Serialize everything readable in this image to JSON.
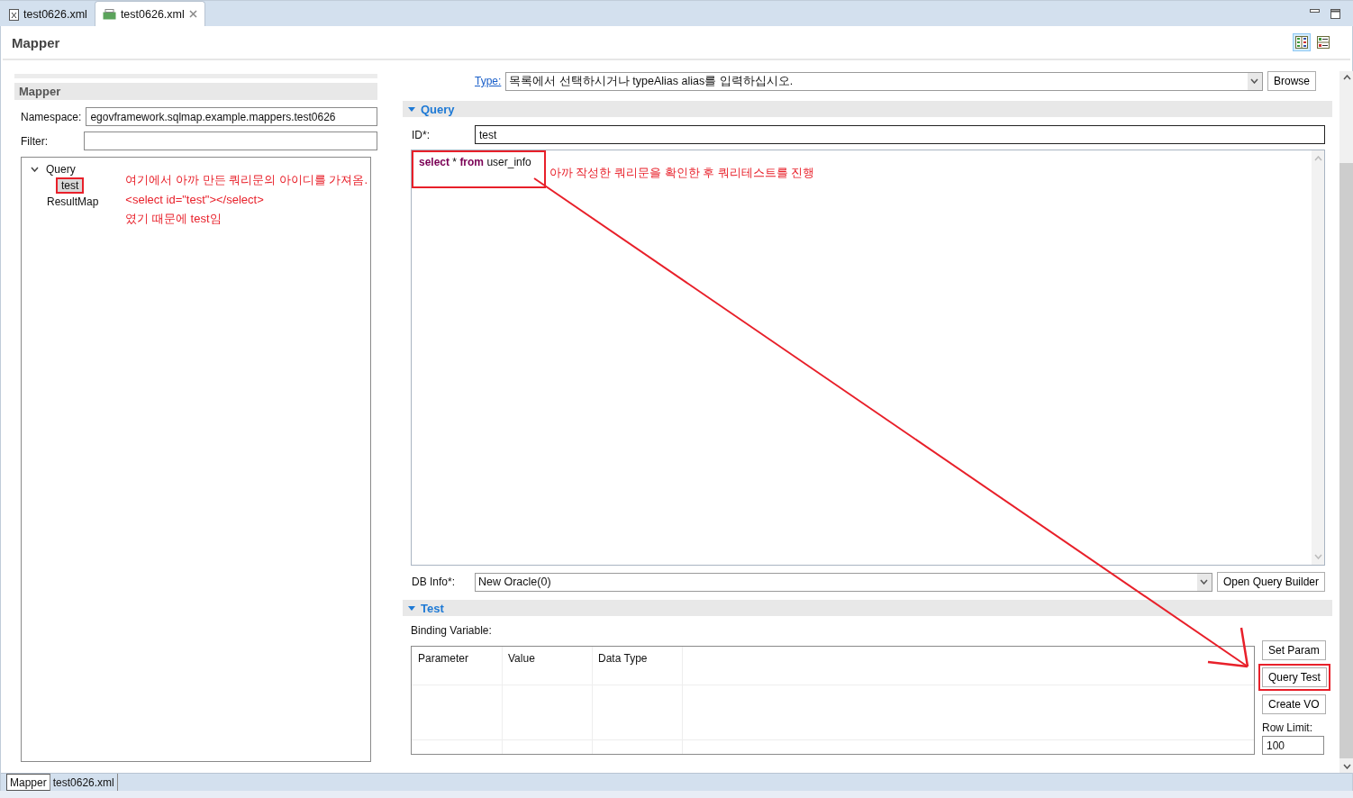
{
  "editor_tabs": [
    {
      "label": "test0626.xml",
      "kind": "xml",
      "selected": false,
      "closable": false
    },
    {
      "label": "test0626.xml",
      "kind": "map",
      "selected": true,
      "closable": true
    }
  ],
  "page_title": "Mapper",
  "view_buttons": [
    {
      "kind": "columns",
      "selected": true
    },
    {
      "kind": "rows",
      "selected": false
    }
  ],
  "mapper": {
    "section_title": "Mapper",
    "namespace_label": "Namespace:",
    "namespace_value": "egovframework.sqlmap.example.mappers.test0626",
    "filter_label": "Filter:",
    "tree": [
      {
        "label": "Query",
        "expanded": true,
        "children": [
          {
            "label": "test",
            "selected": true,
            "annotated": true
          }
        ]
      },
      {
        "label": "ResultMap"
      }
    ],
    "notes": [
      "여기에서 아까 만든 쿼리문의 아이디를 가져옴.",
      "<select id=\"test\"></select>",
      "였기 때문에 test임"
    ]
  },
  "type_row": {
    "label": "Type:",
    "value": "목록에서 선택하시거나 typeAlias alias를 입력하십시오.",
    "button": "Browse"
  },
  "query_section": {
    "title": "Query",
    "expanded": true,
    "id_label": "ID*:",
    "id_value": "test",
    "sql": "**select** * **from** user_info",
    "sql_annotated": true,
    "note": "아까 작성한 쿼리문을 확인한 후 쿼리테스트를 진행",
    "db_label": "DB Info*:",
    "db_value": "New Oracle(0)",
    "builder_button": "Open Query Builder"
  },
  "test_section": {
    "title": "Test",
    "expanded": true,
    "binding_label": "Binding Variable:",
    "columns": [
      "Parameter",
      "Value",
      "Data Type"
    ],
    "buttons": [
      {
        "label": "Set Param",
        "annotated": false
      },
      {
        "label": "Query Test",
        "annotated": true
      },
      {
        "label": "Create VO",
        "annotated": false
      }
    ],
    "row_limit_label": "Row Limit:",
    "row_limit_value": "100"
  },
  "bottom_tabs": [
    {
      "label": "Mapper",
      "selected": true
    },
    {
      "label": "test0626.xml",
      "selected": false
    }
  ]
}
